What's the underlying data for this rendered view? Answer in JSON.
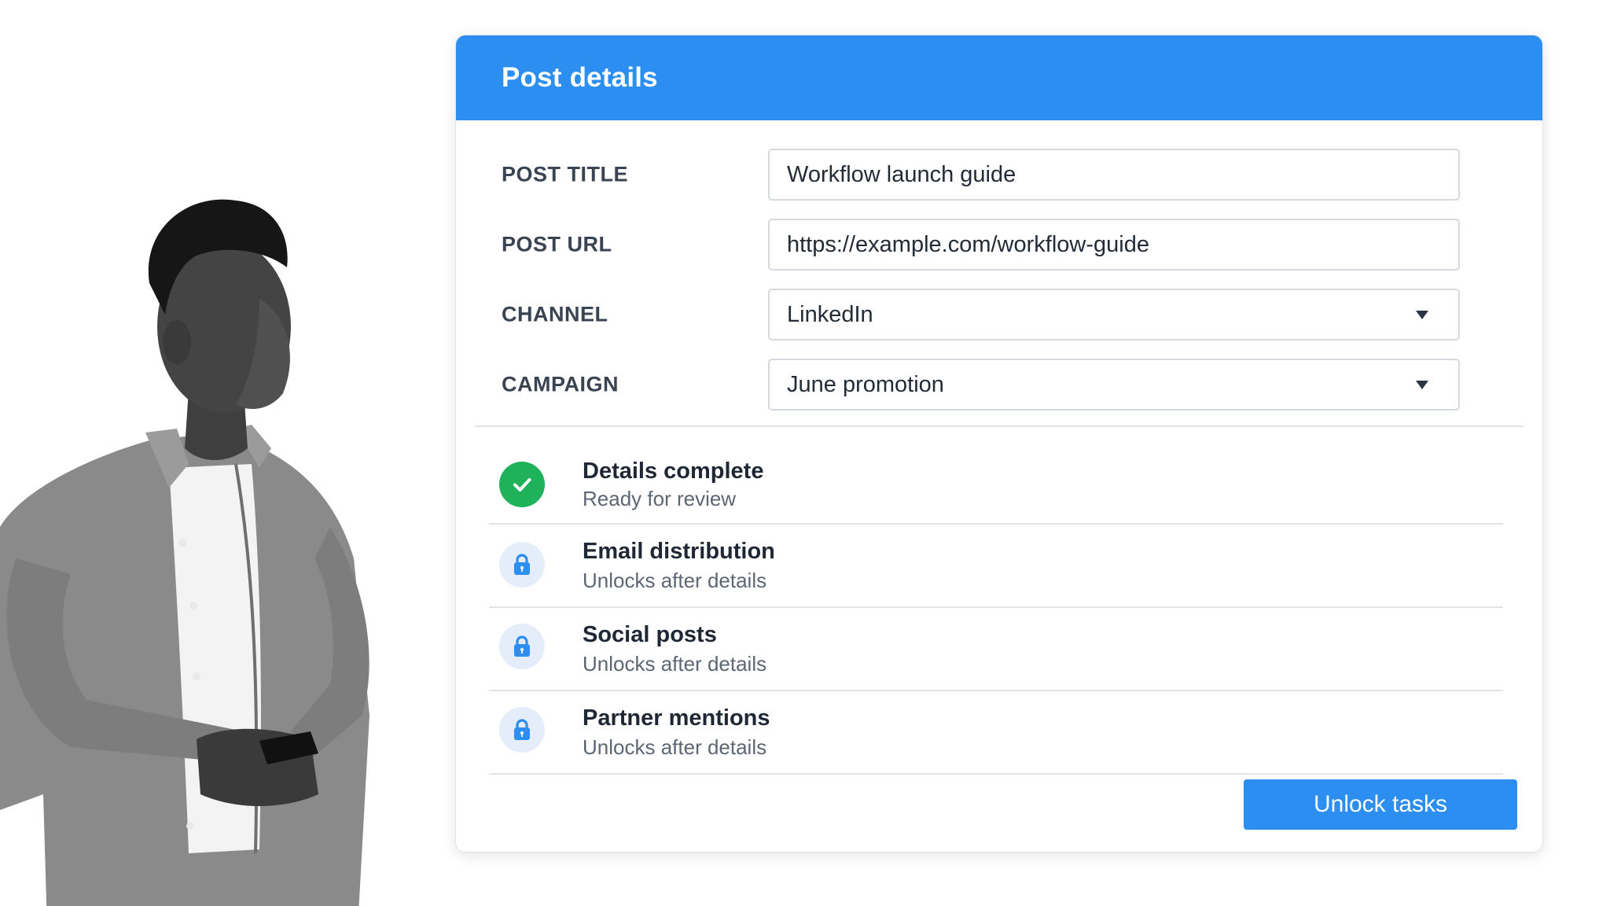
{
  "card": {
    "title": "Post details"
  },
  "form": {
    "fields": [
      {
        "label": "POST TITLE",
        "value": "Workflow launch guide",
        "type": "text"
      },
      {
        "label": "POST URL",
        "value": "https://example.com/workflow-guide",
        "type": "text"
      },
      {
        "label": "CHANNEL",
        "value": "LinkedIn",
        "type": "select"
      },
      {
        "label": "CAMPAIGN",
        "value": "June promotion",
        "type": "select"
      }
    ]
  },
  "tasks": [
    {
      "title": "Details complete",
      "subtitle": "Ready for review",
      "status": "complete",
      "icon": "check-circle-icon"
    },
    {
      "title": "Email distribution",
      "subtitle": "Unlocks after details",
      "status": "locked",
      "icon": "lock-icon"
    },
    {
      "title": "Social posts",
      "subtitle": "Unlocks after details",
      "status": "locked",
      "icon": "lock-icon"
    },
    {
      "title": "Partner mentions",
      "subtitle": "Unlocks after details",
      "status": "locked",
      "icon": "lock-icon"
    }
  ],
  "actions": {
    "unlock_label": "Unlock tasks"
  },
  "colors": {
    "accent": "#2b8ef0",
    "success": "#1fb25a",
    "lock_bg": "#e4edf9"
  }
}
